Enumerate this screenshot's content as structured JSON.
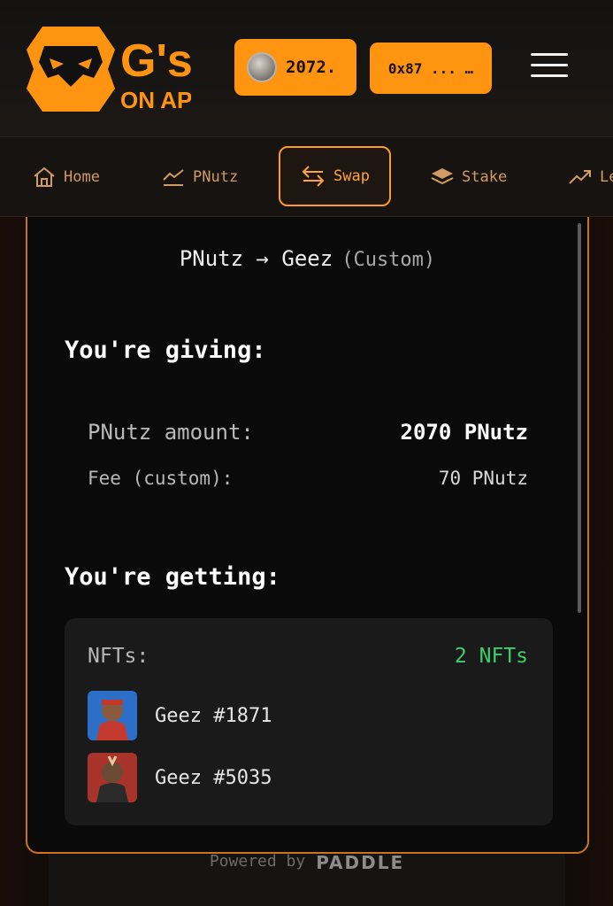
{
  "header": {
    "logo_text": "G's ON APE",
    "balance": "2072.",
    "wallet": "0x87 ... …"
  },
  "nav": {
    "items": [
      {
        "label": "Home",
        "icon": "home-icon"
      },
      {
        "label": "PNutz",
        "icon": "chart-icon"
      },
      {
        "label": "Swap",
        "icon": "swap-arrows-icon",
        "active": true
      },
      {
        "label": "Stake",
        "icon": "layers-icon"
      },
      {
        "label": "Le",
        "icon": "trend-up-icon"
      }
    ]
  },
  "swap": {
    "title": "PNutz → Geez",
    "mode": "(Custom)",
    "giving_heading": "You're giving:",
    "amount_label": "PNutz amount:",
    "amount_value": "2070 PNutz",
    "fee_label": "Fee (custom):",
    "fee_value": "70 PNutz",
    "getting_heading": "You're getting:",
    "nfts_label": "NFTs:",
    "nfts_count": "2 NFTs",
    "nfts": [
      {
        "name": "Geez #1871"
      },
      {
        "name": "Geez #5035"
      }
    ]
  },
  "footer": {
    "powered_by": "Powered by",
    "brand": "PADDLE"
  },
  "colors": {
    "accent": "#ff9410",
    "card_border": "#c9741a",
    "nft_count": "#3ccf6a"
  }
}
